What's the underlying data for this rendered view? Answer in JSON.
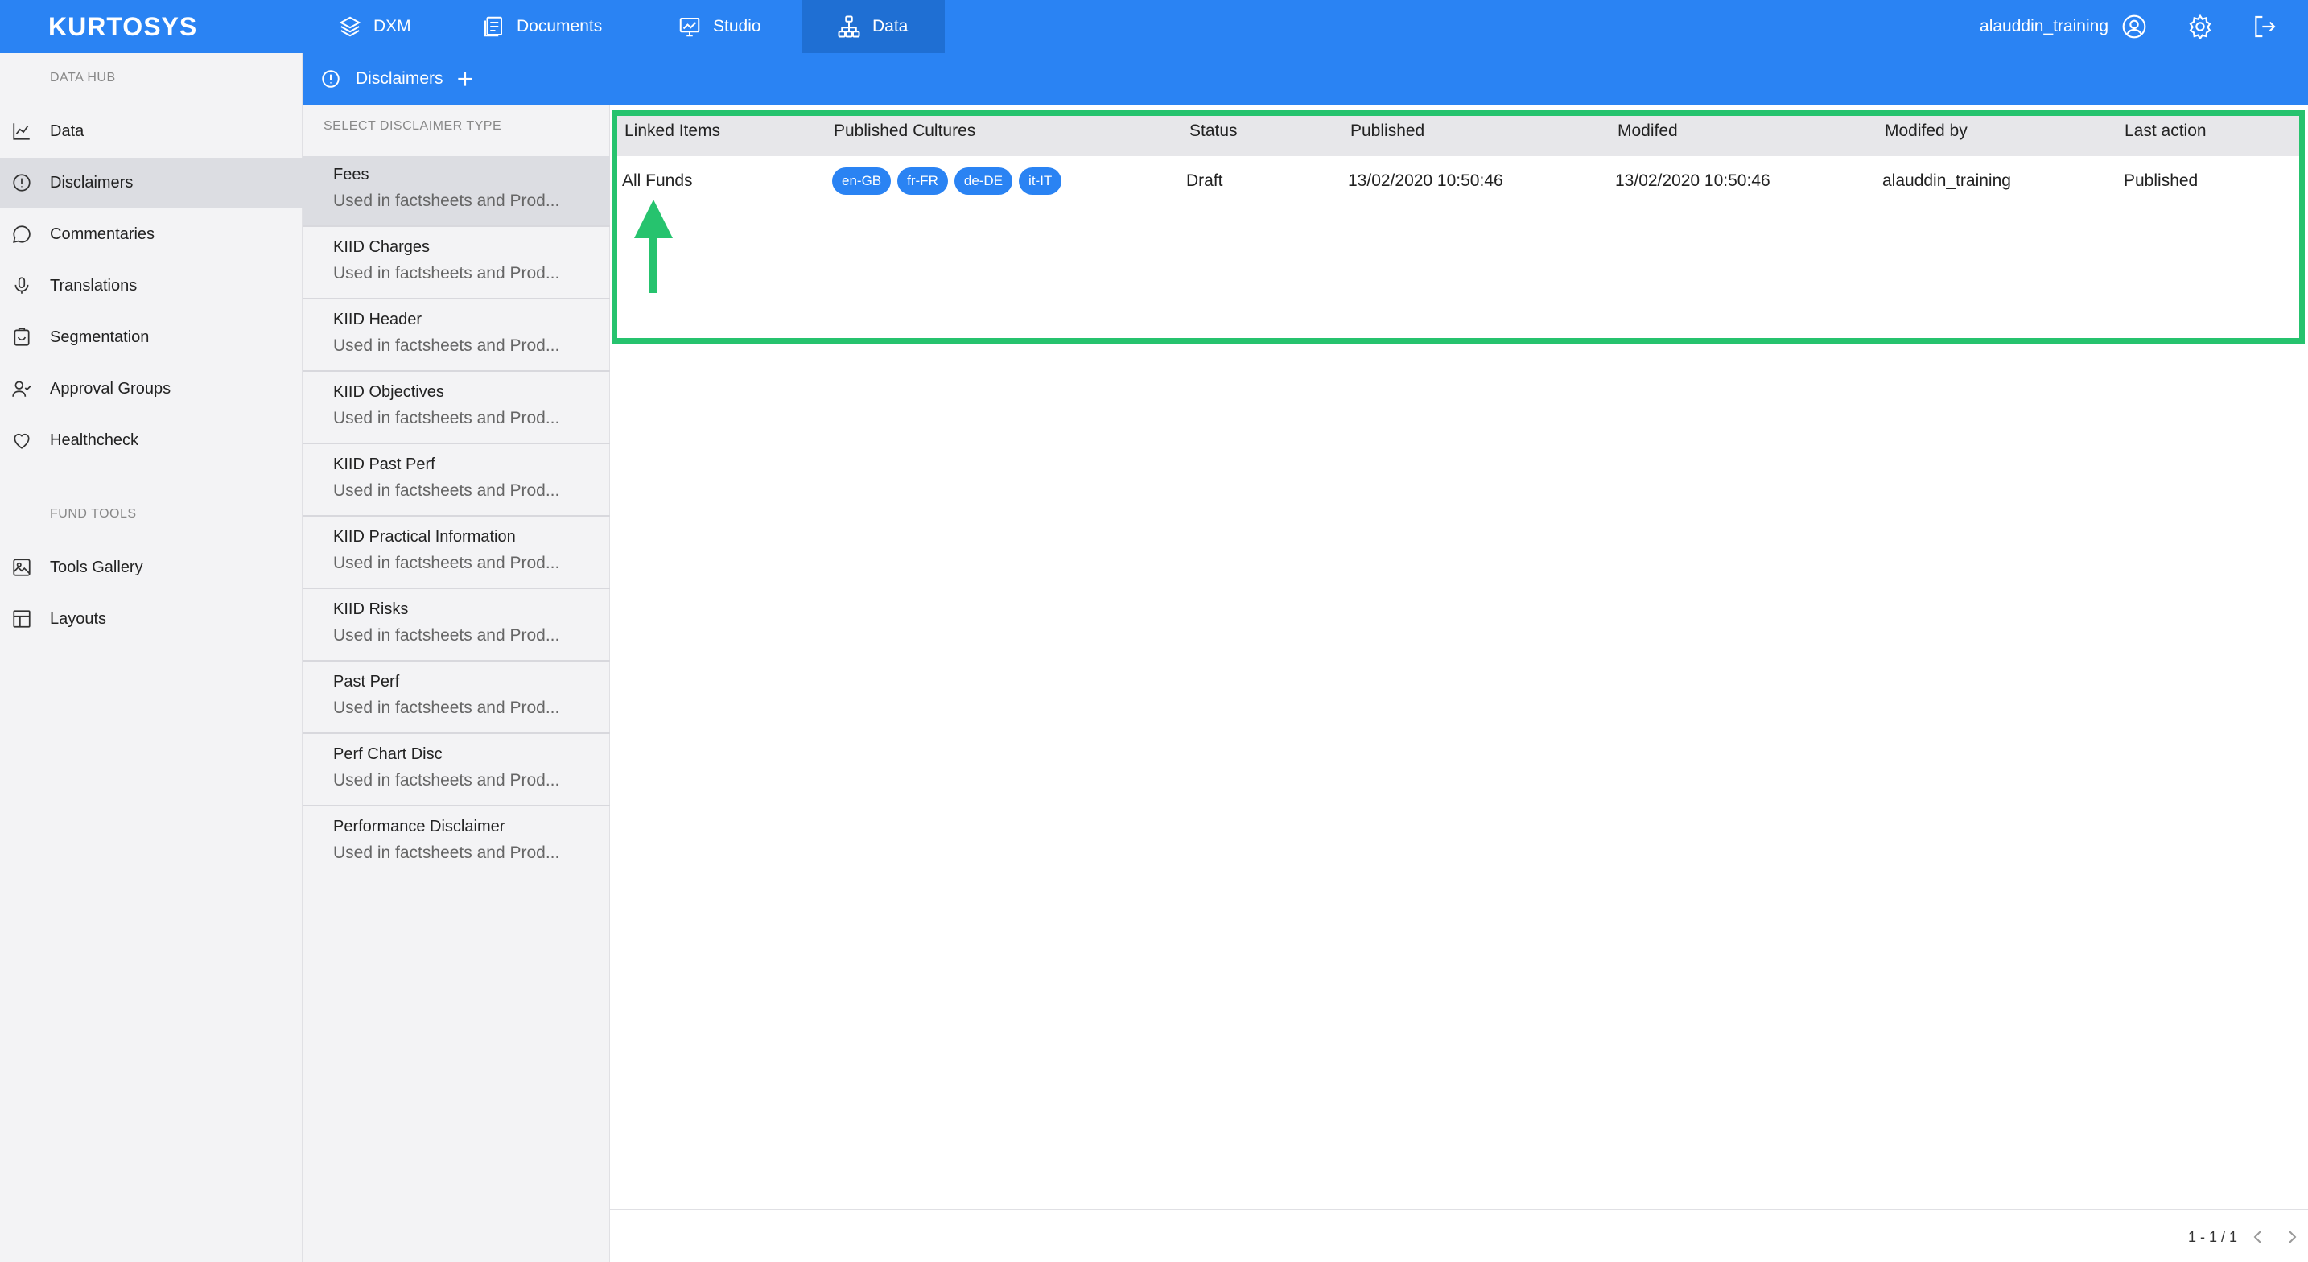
{
  "app": {
    "logo": "KURTOSYS"
  },
  "topnav": {
    "tabs": [
      {
        "label": "DXM",
        "icon": "layers-icon"
      },
      {
        "label": "Documents",
        "icon": "documents-icon"
      },
      {
        "label": "Studio",
        "icon": "studio-icon"
      },
      {
        "label": "Data",
        "icon": "sitemap-icon",
        "active": true
      }
    ],
    "user": "alauddin_training"
  },
  "sidebar": {
    "section_data_hub": "DATA HUB",
    "items": [
      {
        "label": "Data",
        "icon": "chart-icon"
      },
      {
        "label": "Disclaimers",
        "icon": "alert-circle-icon",
        "active": true
      },
      {
        "label": "Commentaries",
        "icon": "comment-icon"
      },
      {
        "label": "Translations",
        "icon": "microphone-icon"
      },
      {
        "label": "Segmentation",
        "icon": "clipboard-icon"
      },
      {
        "label": "Approval Groups",
        "icon": "user-check-icon"
      },
      {
        "label": "Healthcheck",
        "icon": "heart-icon"
      }
    ],
    "section_fund_tools": "FUND TOOLS",
    "tools": [
      {
        "label": "Tools Gallery",
        "icon": "image-icon"
      },
      {
        "label": "Layouts",
        "icon": "layout-icon"
      }
    ]
  },
  "subheader": {
    "title": "Disclaimers"
  },
  "typelist": {
    "heading": "SELECT DISCLAIMER TYPE",
    "items": [
      {
        "name": "Fees",
        "desc": "Used in factsheets and Prod..."
      },
      {
        "name": "KIID Charges",
        "desc": "Used in factsheets and Prod..."
      },
      {
        "name": "KIID Header",
        "desc": "Used in factsheets and Prod..."
      },
      {
        "name": "KIID Objectives",
        "desc": "Used in factsheets and Prod..."
      },
      {
        "name": "KIID Past Perf",
        "desc": "Used in factsheets and Prod..."
      },
      {
        "name": "KIID Practical Information",
        "desc": "Used in factsheets and Prod..."
      },
      {
        "name": "KIID Risks",
        "desc": "Used in factsheets and Prod..."
      },
      {
        "name": "Past Perf",
        "desc": "Used in factsheets and Prod..."
      },
      {
        "name": "Perf Chart Disc",
        "desc": "Used in factsheets and Prod..."
      },
      {
        "name": "Performance Disclaimer",
        "desc": "Used in factsheets and Prod..."
      }
    ]
  },
  "table": {
    "columns": [
      "Linked Items",
      "Published Cultures",
      "Status",
      "Published",
      "Modifed",
      "Modifed by",
      "Last action"
    ],
    "rows": [
      {
        "linked": "All Funds",
        "cultures": [
          "en-GB",
          "fr-FR",
          "de-DE",
          "it-IT"
        ],
        "status": "Draft",
        "published": "13/02/2020 10:50:46",
        "modified": "13/02/2020 10:50:46",
        "modified_by": "alauddin_training",
        "last_action": "Published"
      }
    ]
  },
  "pager": {
    "text": "1 - 1 / 1"
  },
  "colors": {
    "primary": "#2a83f3",
    "highlight": "#26c36e"
  }
}
